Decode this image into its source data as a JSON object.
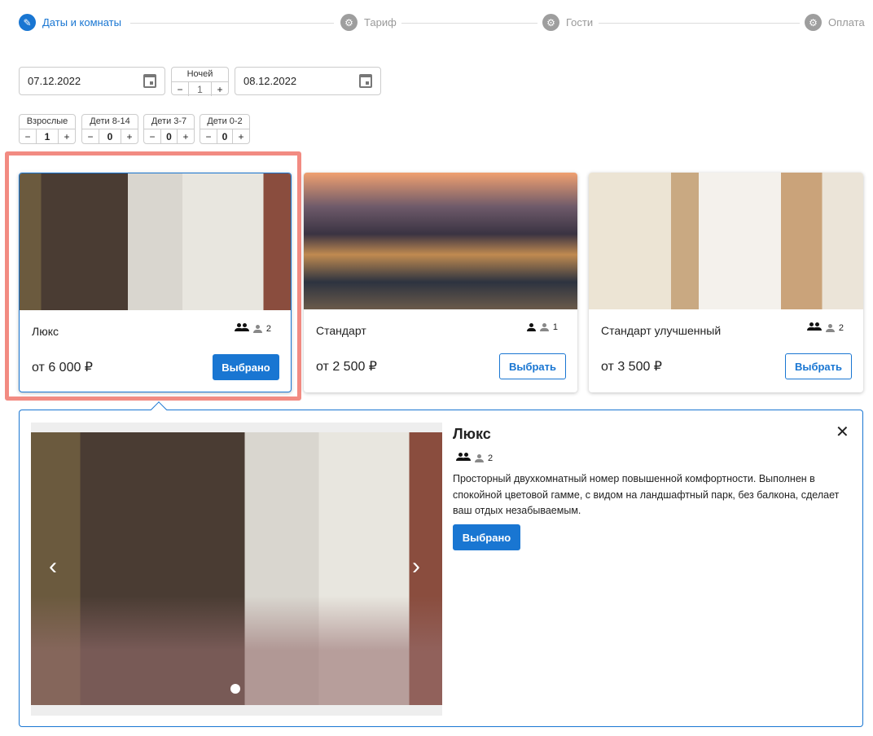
{
  "stepper": [
    {
      "label": "Даты и комнаты",
      "icon": "pencil-icon",
      "active": true
    },
    {
      "label": "Тариф",
      "icon": "gear-icon",
      "active": false
    },
    {
      "label": "Гости",
      "icon": "gear-icon",
      "active": false
    },
    {
      "label": "Оплата",
      "icon": "gear-icon",
      "active": false
    }
  ],
  "dates": {
    "checkin": "07.12.2022",
    "checkout": "08.12.2022",
    "nights_label": "Ночей",
    "nights": "1"
  },
  "counters": [
    {
      "label": "Взрослые",
      "value": "1"
    },
    {
      "label": "Дети 8-14",
      "value": "0"
    },
    {
      "label": "Дети 3-7",
      "value": "0"
    },
    {
      "label": "Дети 0-2",
      "value": "0"
    }
  ],
  "controls": {
    "minus": "−",
    "plus": "+"
  },
  "rooms": [
    {
      "name": "Люкс",
      "extra": "2",
      "price": "от 6 000 ₽",
      "button": "Выбрано",
      "selected": true
    },
    {
      "name": "Стандарт",
      "extra": "1",
      "price": "от 2 500 ₽",
      "button": "Выбрать",
      "selected": false
    },
    {
      "name": "Стандарт улучшенный",
      "extra": "2",
      "price": "от 3 500 ₽",
      "button": "Выбрать",
      "selected": false
    }
  ],
  "detail": {
    "title": "Люкс",
    "extra": "2",
    "description": "Просторный двухкомнатный номер повышенной комфортности. Выполнен в спокойной цветовой гамме, с видом на ландшафтный парк, без балкона, сделает ваш отдых незабываемым.",
    "button": "Выбрано",
    "close": "✕",
    "prev": "‹",
    "next": "›"
  },
  "colors": {
    "accent": "#1976d2",
    "highlight": "#f28b82"
  }
}
